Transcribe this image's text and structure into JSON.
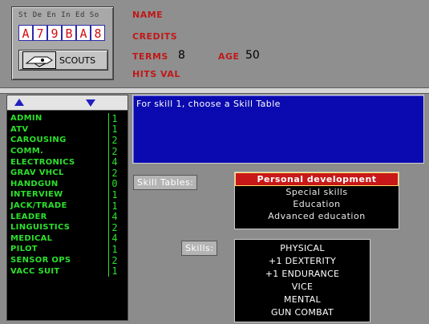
{
  "character": {
    "upp_labels": "St De En In Ed So",
    "upp": [
      "A",
      "7",
      "9",
      "B",
      "A",
      "8"
    ],
    "service": "SCOUTS",
    "service_icon": "scout-ship-icon"
  },
  "stats": {
    "name_label": "NAME",
    "credits_label": "CREDITS",
    "terms_label": "TERMS",
    "terms_value": "8",
    "age_label": "AGE",
    "age_value": "50",
    "hits_label": "HITS VAL"
  },
  "skills": [
    {
      "name": "ADMIN",
      "level": "1"
    },
    {
      "name": "ATV",
      "level": "1"
    },
    {
      "name": "CAROUSING",
      "level": "2"
    },
    {
      "name": "COMM.",
      "level": "2"
    },
    {
      "name": "ELECTRONICS",
      "level": "4"
    },
    {
      "name": "GRAV VHCL",
      "level": "2"
    },
    {
      "name": "HANDGUN",
      "level": "0"
    },
    {
      "name": "INTERVIEW",
      "level": "1"
    },
    {
      "name": "JACK/TRADE",
      "level": "1"
    },
    {
      "name": "LEADER",
      "level": "4"
    },
    {
      "name": "LINGUISTICS",
      "level": "2"
    },
    {
      "name": "MEDICAL",
      "level": "4"
    },
    {
      "name": "PILOT",
      "level": "1"
    },
    {
      "name": "SENSOR OPS",
      "level": "2"
    },
    {
      "name": "VACC SUIT",
      "level": "1"
    }
  ],
  "message": "For skill 1, choose a Skill Table",
  "skill_tables_label": "Skill Tables:",
  "skill_tables": [
    "Personal development",
    "Special skills",
    "Education",
    "Advanced education"
  ],
  "skills_label": "Skills:",
  "skill_options": [
    "PHYSICAL",
    "+1 DEXTERITY",
    "+1 ENDURANCE",
    "VICE",
    "MENTAL",
    "GUN COMBAT"
  ],
  "colors": {
    "skill_text": "#2ce02c",
    "message_bg": "#0a0ab0",
    "selected": "#c81818",
    "stat_label": "#c01818"
  }
}
